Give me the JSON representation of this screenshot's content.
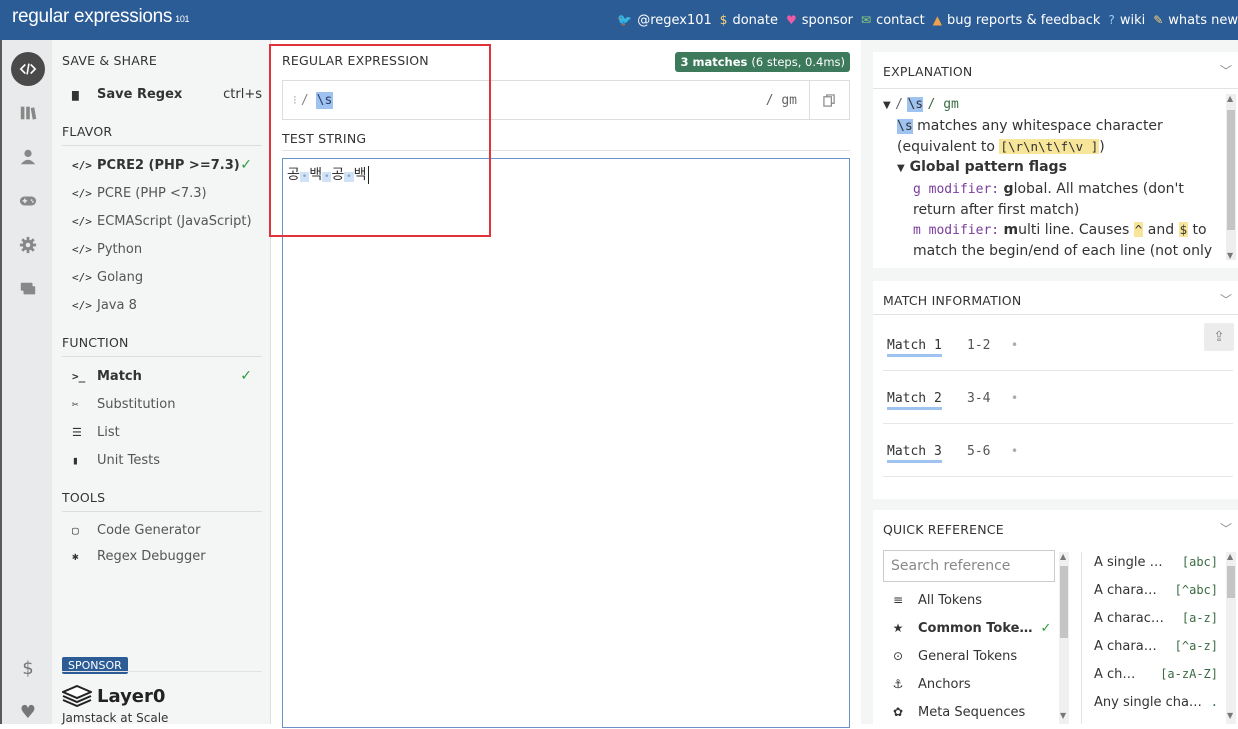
{
  "header": {
    "logo": "regular expressions",
    "logo_version": "101",
    "links": [
      {
        "icon": "twitter-icon",
        "glyph": "🐦",
        "label": "@regex101",
        "color": "#9ecbf5"
      },
      {
        "icon": "dollar-icon",
        "glyph": "$",
        "label": "donate",
        "color": "#f7d27a"
      },
      {
        "icon": "heart-icon",
        "glyph": "♥",
        "label": "sponsor",
        "color": "#ef5aa5"
      },
      {
        "icon": "mail-icon",
        "glyph": "✉",
        "label": "contact",
        "color": "#8cd07a"
      },
      {
        "icon": "warning-icon",
        "glyph": "▲",
        "label": "bug reports & feedback",
        "color": "#f0a24a"
      },
      {
        "icon": "wiki-icon",
        "glyph": "?",
        "label": "wiki",
        "color": "#9ecbf5"
      },
      {
        "icon": "whats-new-icon",
        "glyph": "✎",
        "label": "whats new",
        "color": "#f7d27a"
      }
    ]
  },
  "menu": {
    "save_share": {
      "title": "SAVE & SHARE",
      "save_label": "Save Regex",
      "shortcut": "ctrl+s"
    },
    "flavor": {
      "title": "FLAVOR",
      "items": [
        "PCRE2 (PHP >=7.3)",
        "PCRE (PHP <7.3)",
        "ECMAScript (JavaScript)",
        "Python",
        "Golang",
        "Java 8"
      ]
    },
    "function": {
      "title": "FUNCTION",
      "items": [
        "Match",
        "Substitution",
        "List",
        "Unit Tests"
      ]
    },
    "tools": {
      "title": "TOOLS",
      "items": [
        "Code Generator",
        "Regex Debugger"
      ]
    },
    "sponsor": {
      "badge": "SPONSOR",
      "name": "Layer0",
      "tagline": "Jamstack at Scale"
    }
  },
  "editor": {
    "regex_label": "REGULAR EXPRESSION",
    "match_count": "3 matches",
    "match_stats": "(6 steps, 0.4ms)",
    "delimiter": "/",
    "pattern": "\\s",
    "flags": "/ gm",
    "test_label": "TEST STRING",
    "test_chars": [
      "공",
      "백",
      "공",
      "백"
    ],
    "whitespace_marker": "•"
  },
  "explanation": {
    "title": "EXPLANATION",
    "tree_slash1": "/",
    "tree_pattern": "\\s",
    "tree_flags": "/ gm",
    "token": "\\s",
    "desc_1": " matches any whitespace character",
    "desc_2a": "(equivalent to ",
    "equiv": "[\\r\\n\\t\\f\\v ]",
    "desc_2b": ")",
    "flags_title": "Global pattern flags",
    "g_mod": "g modifier:",
    "g_letter": "g",
    "g_desc": "lobal. All matches (don't return after first match)",
    "m_mod": "m modifier:",
    "m_letter": "m",
    "m_desc_1": "ulti line. Causes ",
    "caret": "^",
    "and": " and ",
    "dollar": "$",
    "m_desc_2": " to match the begin/end of each line (not only begin/end of string)"
  },
  "match_info": {
    "title": "MATCH INFORMATION",
    "matches": [
      {
        "name": "Match 1",
        "range": "1-2",
        "value": "•"
      },
      {
        "name": "Match 2",
        "range": "3-4",
        "value": "•"
      },
      {
        "name": "Match 3",
        "range": "5-6",
        "value": "•"
      }
    ]
  },
  "quick_ref": {
    "title": "QUICK REFERENCE",
    "search_placeholder": "Search reference",
    "categories": [
      {
        "icon": "layers-icon",
        "glyph": "≡",
        "label": "All Tokens"
      },
      {
        "icon": "star-icon",
        "glyph": "★",
        "label": "Common Toke…",
        "checked": true
      },
      {
        "icon": "circle-dot-icon",
        "glyph": "⊙",
        "label": "General Tokens"
      },
      {
        "icon": "anchor-icon",
        "glyph": "⚓",
        "label": "Anchors"
      },
      {
        "icon": "meta-icon",
        "glyph": "✿",
        "label": "Meta Sequences"
      }
    ],
    "tokens": [
      {
        "desc": "A single …",
        "token": "[abc]"
      },
      {
        "desc": "A chara…",
        "token": "[^abc]"
      },
      {
        "desc": "A charac…",
        "token": "[a-z]"
      },
      {
        "desc": "A chara…",
        "token": "[^a-z]"
      },
      {
        "desc": "A ch…",
        "token": "[a-zA-Z]"
      },
      {
        "desc": "Any single cha…",
        "token": "."
      }
    ]
  },
  "check": "✓"
}
